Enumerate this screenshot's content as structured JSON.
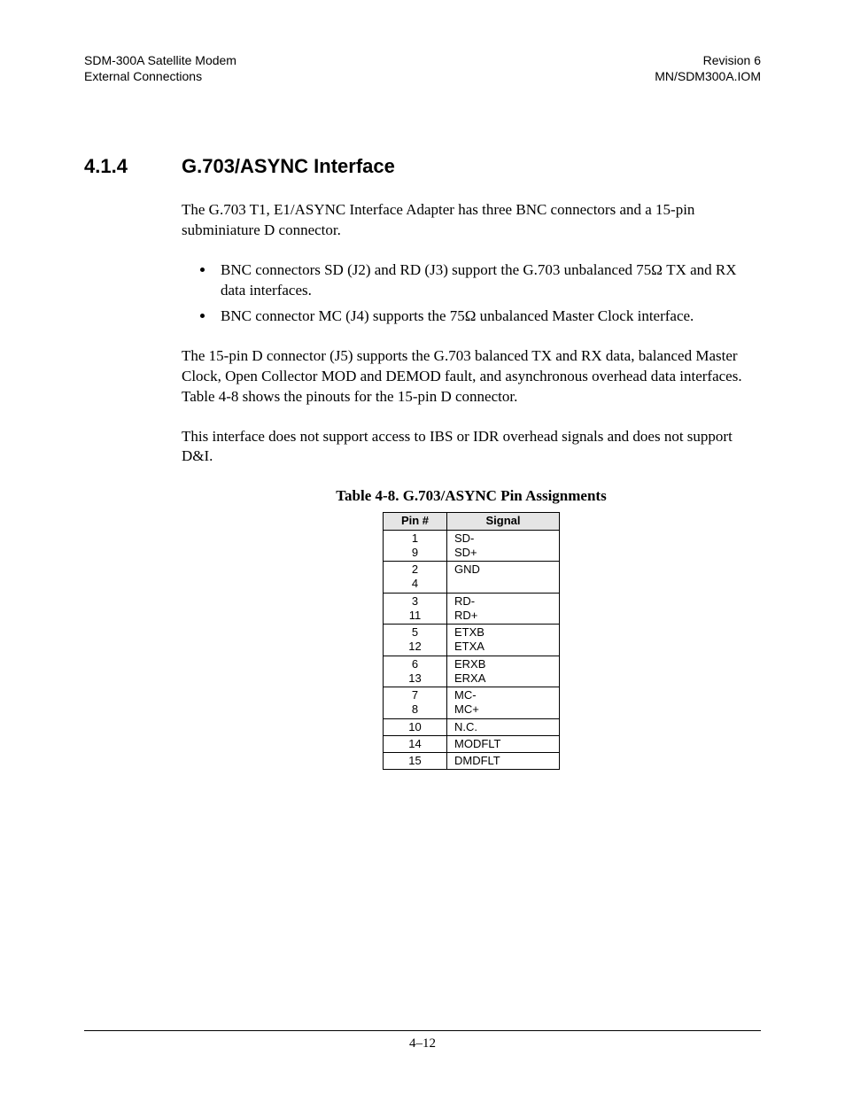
{
  "header": {
    "left_line1": "SDM-300A Satellite Modem",
    "left_line2": "External Connections",
    "right_line1": "Revision 6",
    "right_line2": "MN/SDM300A.IOM"
  },
  "section": {
    "number": "4.1.4",
    "title": "G.703/ASYNC Interface"
  },
  "paragraphs": {
    "intro": "The G.703 T1, E1/ASYNC Interface Adapter has three BNC connectors and a 15-pin subminiature D connector.",
    "p2": "The 15-pin D connector (J5) supports the G.703 balanced TX and RX data, balanced Master Clock, Open Collector MOD and DEMOD fault, and asynchronous  overhead data interfaces. Table 4-8 shows the pinouts for the 15-pin D connector.",
    "p3": "This interface does not support access to IBS or IDR overhead signals and does not support D&I."
  },
  "bullets": [
    "BNC connectors SD (J2) and RD (J3) support the G.703 unbalanced 75Ω TX and RX data interfaces.",
    "BNC connector MC (J4) supports the 75Ω unbalanced Master Clock interface."
  ],
  "table": {
    "caption": "Table 4-8.  G.703/ASYNC Pin Assignments",
    "headers": {
      "col1": "Pin #",
      "col2": "Signal"
    },
    "rows": [
      {
        "pin": "1\n9",
        "signal": "SD-\nSD+"
      },
      {
        "pin": "2\n4",
        "signal": "GND"
      },
      {
        "pin": "3\n11",
        "signal": "RD-\nRD+"
      },
      {
        "pin": "5\n12",
        "signal": "ETXB\nETXA"
      },
      {
        "pin": "6\n13",
        "signal": "ERXB\nERXA"
      },
      {
        "pin": "7\n8",
        "signal": "MC-\nMC+"
      },
      {
        "pin": "10",
        "signal": "N.C."
      },
      {
        "pin": "14",
        "signal": "MODFLT"
      },
      {
        "pin": "15",
        "signal": "DMDFLT"
      }
    ]
  },
  "footer": {
    "page_number": "4–12"
  }
}
